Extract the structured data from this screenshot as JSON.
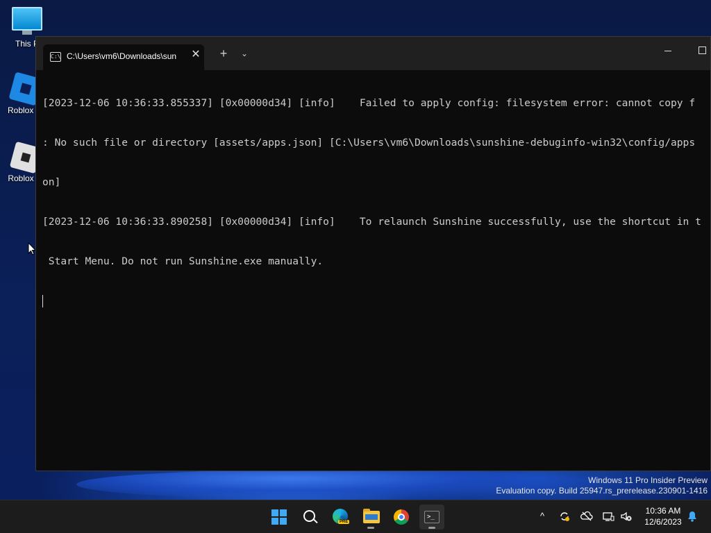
{
  "desktop": {
    "icons": [
      {
        "label": "This P",
        "name": "this-pc"
      },
      {
        "label": "Roblox St",
        "name": "roblox-studio"
      },
      {
        "label": "Roblox Pl",
        "name": "roblox-player"
      }
    ]
  },
  "terminal": {
    "tab_title": "C:\\Users\\vm6\\Downloads\\sun",
    "tab_icon_text": "C:\\",
    "close_glyph": "✕",
    "newtab_glyph": "+",
    "dropdown_glyph": "⌄",
    "lines": [
      "[2023-12-06 10:36:33.855337] [0x00000d34] [info]    Failed to apply config: filesystem error: cannot copy f",
      ": No such file or directory [assets/apps.json] [C:\\Users\\vm6\\Downloads\\sunshine-debuginfo-win32\\config/apps",
      "on]",
      "[2023-12-06 10:36:33.890258] [0x00000d34] [info]    To relaunch Sunshine successfully, use the shortcut in t",
      " Start Menu. Do not run Sunshine.exe manually."
    ]
  },
  "watermark": {
    "line1": "Windows 11 Pro Insider Preview",
    "line2": "Evaluation copy. Build 25947.rs_prerelease.230901-1416"
  },
  "taskbar": {
    "edge_badge": "PRE",
    "terminal_glyph": ">_",
    "clock_time": "10:36 AM",
    "clock_date": "12/6/2023",
    "tray_chevron": "^"
  },
  "colors": {
    "terminal_bg": "#0c0c0c",
    "titlebar_bg": "#202020",
    "taskbar_bg": "#1c1c1c",
    "windows_blue": "#3fa9f5"
  }
}
